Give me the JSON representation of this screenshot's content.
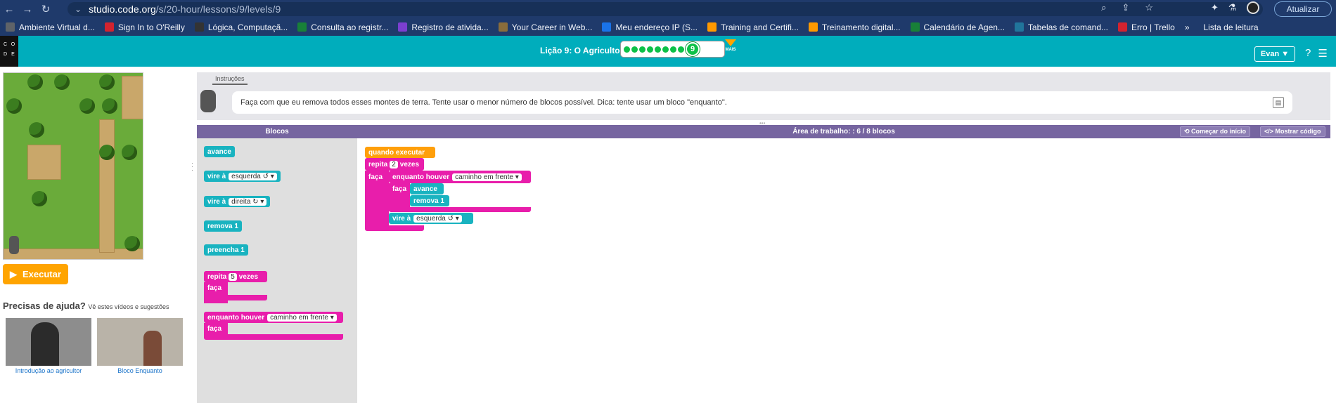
{
  "browser": {
    "url_host": "studio.code.org",
    "url_path": "/s/20-hour/lessons/9/levels/9",
    "update_label": "Atualizar",
    "bookmarks": [
      {
        "label": "Ambiente Virtual d...",
        "color": "#5f6368"
      },
      {
        "label": "Sign In to O'Reilly",
        "color": "#d3232f"
      },
      {
        "label": "Lógica, Computaçã...",
        "color": "#333333"
      },
      {
        "label": "Consulta ao registr...",
        "color": "#188038"
      },
      {
        "label": "Registro de ativida...",
        "color": "#7b3fd0"
      },
      {
        "label": "Your Career in Web...",
        "color": "#8a6d3b"
      },
      {
        "label": "Meu endereço IP (S...",
        "color": "#1a73e8"
      },
      {
        "label": "Training and Certifi...",
        "color": "#ff9900"
      },
      {
        "label": "Treinamento digital...",
        "color": "#ff9900"
      },
      {
        "label": "Calendário de Agen...",
        "color": "#188038"
      },
      {
        "label": "Tabelas de comand...",
        "color": "#21759b"
      },
      {
        "label": "Erro | Trello",
        "color": "#d3232f"
      }
    ],
    "more_bookmarks": "»",
    "reading_list": "Lista de leitura"
  },
  "header": {
    "logo_letters": [
      "C",
      "O",
      "D",
      "E"
    ],
    "lesson_title": "Lição 9: O Agricultor",
    "completed_dots": 8,
    "current_level": "9",
    "more_label": "MAIS",
    "user_label": "Evan ▼",
    "help_icon": "?",
    "menu_icon": "☰"
  },
  "left": {
    "run_label": "Executar",
    "help_title": "Precisas de ajuda?",
    "help_sub": "Vê estes vídeos e sugestões",
    "videos": [
      {
        "caption": "Introdução ao agricultor"
      },
      {
        "caption": "Bloco Enquanto"
      }
    ]
  },
  "instructions": {
    "tab": "Instruções",
    "text": "Faça com que eu remova todos esses montes de terra. Tente usar o menor número de blocos possível. Dica: tente usar um bloco \"enquanto\"."
  },
  "workspace_header": {
    "blocks_label": "Blocos",
    "area_label": "Área de trabalho: : 6 / 8 blocos",
    "restart_label": "⟲ Começar do início",
    "show_code_label": "</> Mostrar código"
  },
  "toolbox": {
    "avance": "avance",
    "vire_left": "vire à",
    "left_dir": "esquerda ↺ ▾",
    "vire_right": "vire à",
    "right_dir": "direita ↻ ▾",
    "remova": "remova 1",
    "preencha": "preencha 1",
    "repita": "repita",
    "repita_num": "5",
    "vezes": "vezes",
    "faca": "faça",
    "enquanto": "enquanto houver",
    "enquanto_cond": "caminho em frente ▾",
    "faca2": "faça"
  },
  "program": {
    "when_run": "quando executar",
    "repita": "repita",
    "repita_num": "2",
    "vezes": "vezes",
    "faca": "faça",
    "enquanto": "enquanto houver",
    "enquanto_cond": "caminho em frente ▾",
    "faca_inner": "faça",
    "avance": "avance",
    "remova": "remova 1",
    "vire": "vire à",
    "vire_dir": "esquerda ↺ ▾"
  }
}
